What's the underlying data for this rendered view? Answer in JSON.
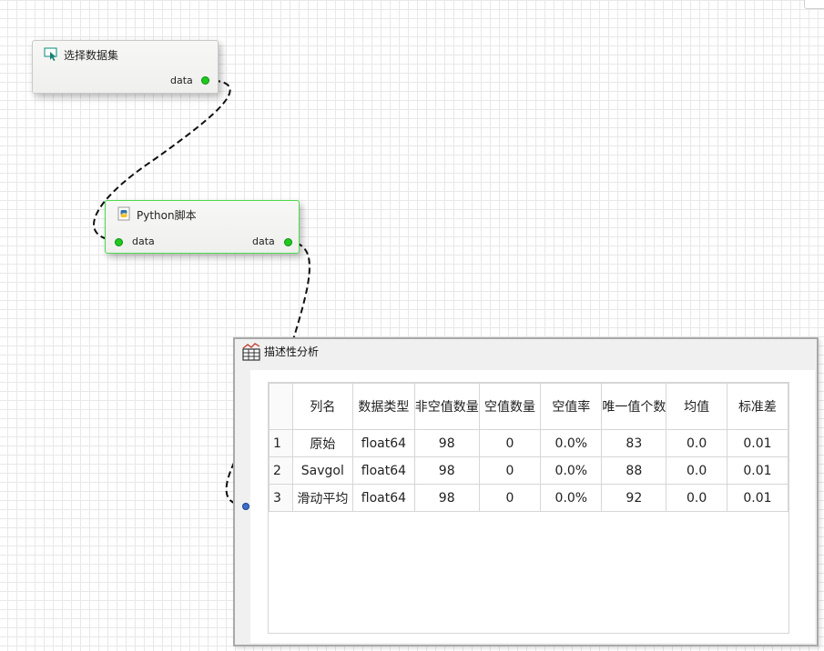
{
  "nodes": {
    "select_dataset": {
      "title": "选择数据集",
      "output_label": "data"
    },
    "python_script": {
      "title": "Python脚本",
      "input_label": "data",
      "output_label": "data"
    }
  },
  "panel": {
    "title": "描述性分析",
    "columns": [
      "列名",
      "数据类型",
      "非空值数量",
      "空值数量",
      "空值率",
      "唯一值个数",
      "均值",
      "标准差"
    ],
    "rows": [
      {
        "index": "1",
        "cells": [
          "原始",
          "float64",
          "98",
          "0",
          "0.0%",
          "83",
          "0.0",
          "0.01"
        ]
      },
      {
        "index": "2",
        "cells": [
          "Savgol",
          "float64",
          "98",
          "0",
          "0.0%",
          "88",
          "0.0",
          "0.01"
        ]
      },
      {
        "index": "3",
        "cells": [
          "滑动平均",
          "float64",
          "98",
          "0",
          "0.0%",
          "92",
          "0.0",
          "0.01"
        ]
      }
    ]
  },
  "colors": {
    "port_green": "#1fc91f",
    "port_blue": "#3b6fd1",
    "python_node_border": "#4cd94c"
  },
  "icons": {
    "select_dataset": "cursor-select-icon",
    "python_script": "python-icon",
    "descriptive_analysis": "bar-chart-table-icon"
  }
}
